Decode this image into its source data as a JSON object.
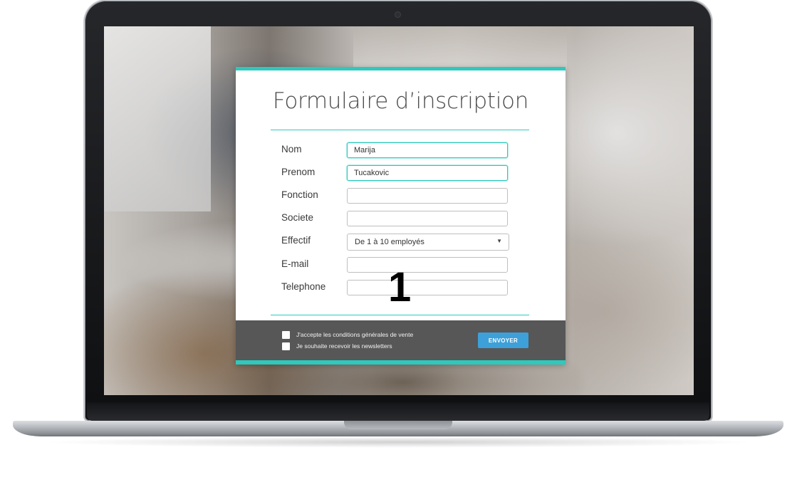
{
  "form": {
    "title": "Formulaire d’inscription",
    "fields": [
      {
        "label": "Nom",
        "value": "Marija"
      },
      {
        "label": "Prenom",
        "value": "Tucakovic"
      },
      {
        "label": "Fonction",
        "value": ""
      },
      {
        "label": "Societe",
        "value": ""
      },
      {
        "label": "Effectif",
        "value": "De 1 à 10 employés"
      },
      {
        "label": "E-mail",
        "value": ""
      },
      {
        "label": "Telephone",
        "value": ""
      }
    ],
    "overlay_number": "1",
    "checkboxes": [
      {
        "label": "J'accepte les conditions générales de vente",
        "checked": false
      },
      {
        "label": "Je souhaite recevoir les newsletters",
        "checked": false
      }
    ],
    "submit_label": "ENVOYER",
    "select_arrow": "▼"
  },
  "colors": {
    "accent": "#2ec9bc",
    "button": "#3da0d8",
    "footer": "#575757"
  },
  "icons": {
    "select": "chevron-down-icon"
  }
}
